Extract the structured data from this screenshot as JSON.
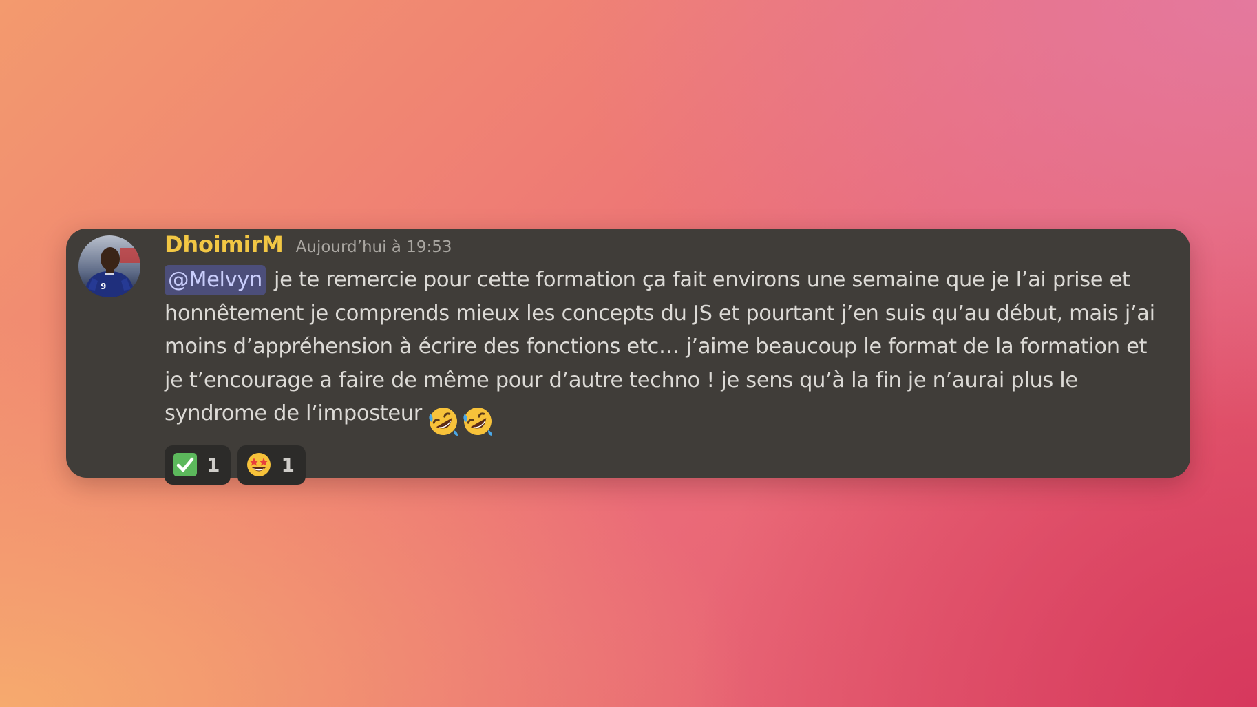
{
  "message": {
    "username": "DhoimirM",
    "timestamp": "Aujourd’hui à 19:53",
    "mention": "@Melvyn",
    "text": "je te remercie pour cette formation ça fait environs une semaine que je l’ai prise et honnêtement je comprends mieux les concepts du JS et pourtant j’en suis qu’au début, mais j’ai moins d’appréhension à écrire des fonctions etc… j’aime beaucoup le format de la formation et je t’encourage a faire de même pour d’autre techno ! je sens qu’à la fin je n’aurai plus le syndrome de l’imposteur",
    "inline_emojis": [
      "rolling-on-floor-laughing-emoji",
      "rolling-on-floor-laughing-emoji"
    ],
    "avatar_icon": "user-avatar-icon",
    "reactions": [
      {
        "emoji": "check-mark-button-emoji",
        "count": "1"
      },
      {
        "emoji": "star-struck-emoji",
        "count": "1"
      }
    ]
  },
  "colors": {
    "card_background": "#403d39",
    "username": "#f2c744",
    "mention_background": "#4c4e7a",
    "mention_text": "#c9cdfb",
    "reaction_background": "#2c2b29"
  }
}
